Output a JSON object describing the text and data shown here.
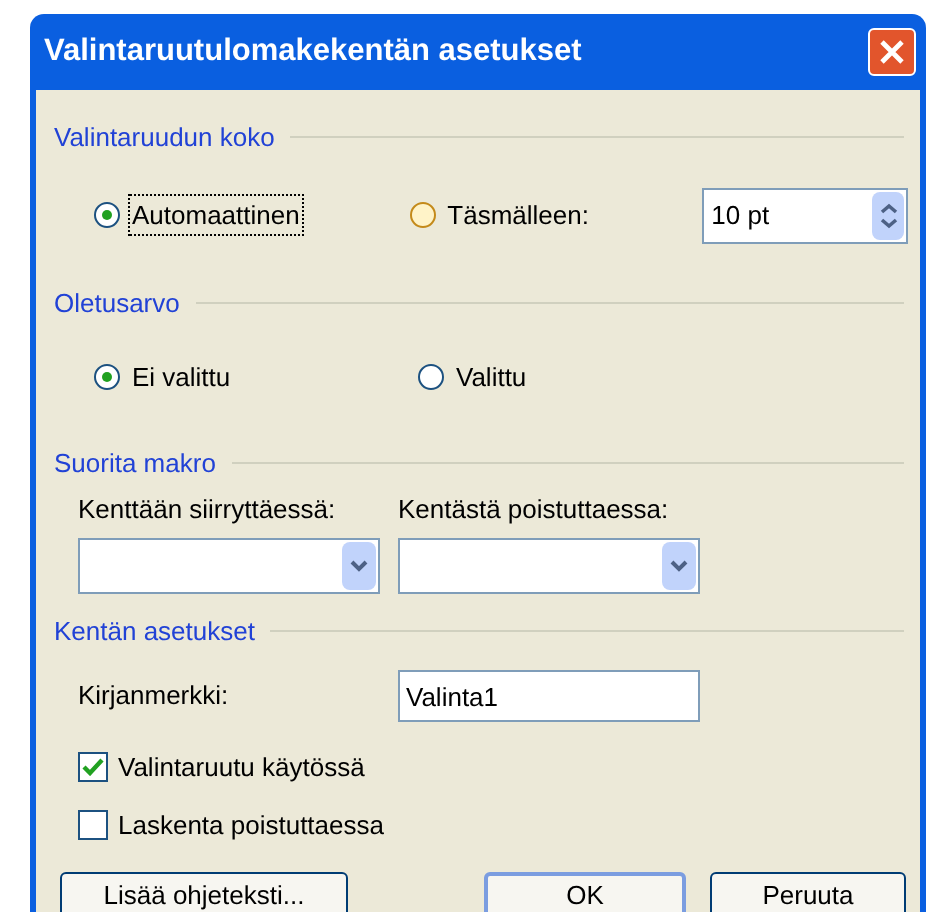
{
  "window": {
    "title": "Valintaruutulomakekentän asetukset"
  },
  "size_group": {
    "heading": "Valintaruudun koko",
    "options": [
      {
        "label": "Automaattinen",
        "selected": true,
        "focused": true,
        "hovered": false
      },
      {
        "label": "Täsmälleen:",
        "selected": false,
        "focused": false,
        "hovered": true
      }
    ],
    "size_field": {
      "value": "10 pt"
    }
  },
  "default_group": {
    "heading": "Oletusarvo",
    "options": [
      {
        "label": "Ei valittu",
        "selected": true
      },
      {
        "label": "Valittu",
        "selected": false
      }
    ]
  },
  "macro_group": {
    "heading": "Suorita makro",
    "entry_label": "Kenttään siirryttäessä:",
    "exit_label": "Kentästä poistuttaessa:"
  },
  "field_group": {
    "heading": "Kentän asetukset",
    "bookmark_label": "Kirjanmerkki:",
    "bookmark_value": "Valinta1",
    "checkboxes": [
      {
        "label": "Valintaruutu käytössä",
        "checked": true
      },
      {
        "label": "Laskenta poistuttaessa",
        "checked": false
      }
    ]
  },
  "buttons": [
    {
      "label": "Lisää ohjeteksti...",
      "default": false
    },
    {
      "label": "OK",
      "default": true
    },
    {
      "label": "Peruuta",
      "default": false
    }
  ]
}
